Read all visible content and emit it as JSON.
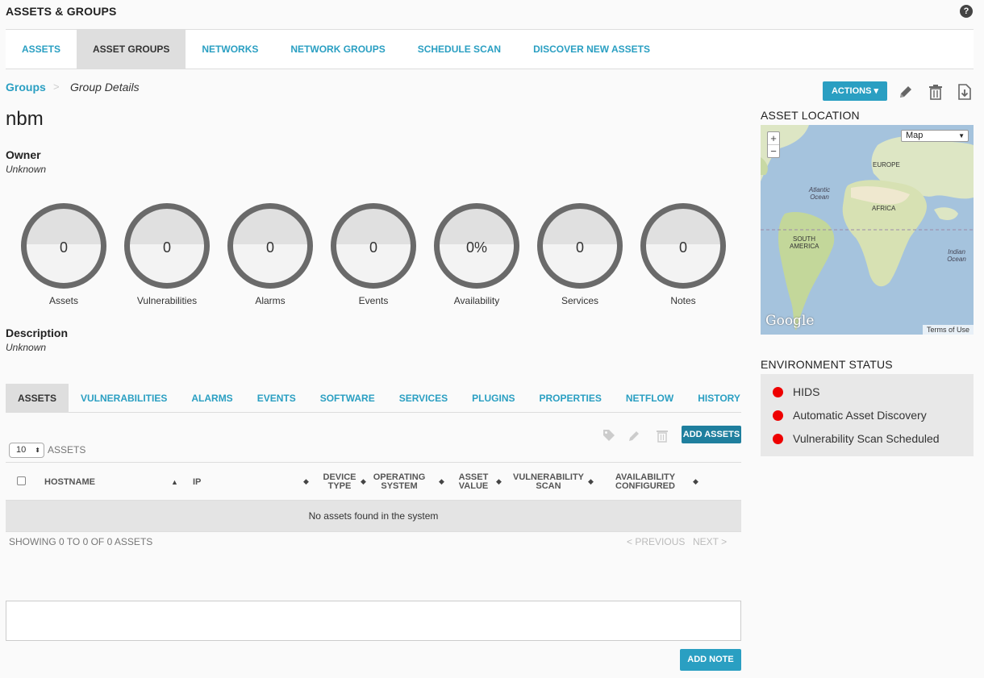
{
  "header": {
    "title": "ASSETS & GROUPS",
    "help_icon": "?"
  },
  "main_tabs": [
    {
      "label": "ASSETS"
    },
    {
      "label": "ASSET GROUPS"
    },
    {
      "label": "NETWORKS"
    },
    {
      "label": "NETWORK GROUPS"
    },
    {
      "label": "SCHEDULE SCAN"
    },
    {
      "label": "DISCOVER NEW ASSETS"
    }
  ],
  "breadcrumb": {
    "link": "Groups",
    "sep": ">",
    "current": "Group Details"
  },
  "toolbar": {
    "actions_label": "ACTIONS ▾"
  },
  "group": {
    "name": "nbm",
    "owner_label": "Owner",
    "owner_value": "Unknown",
    "description_label": "Description",
    "description_value": "Unknown"
  },
  "stats": [
    {
      "value": "0",
      "label": "Assets"
    },
    {
      "value": "0",
      "label": "Vulnerabilities"
    },
    {
      "value": "0",
      "label": "Alarms"
    },
    {
      "value": "0",
      "label": "Events"
    },
    {
      "value": "0%",
      "label": "Availability"
    },
    {
      "value": "0",
      "label": "Services"
    },
    {
      "value": "0",
      "label": "Notes"
    }
  ],
  "location": {
    "title": "ASSET LOCATION",
    "map_type": "Map",
    "zoom_in": "+",
    "zoom_out": "−",
    "labels": [
      "EUROPE",
      "Atlantic Ocean",
      "AFRICA",
      "SOUTH AMERICA",
      "Indian Ocean"
    ],
    "google": "Google",
    "terms": "Terms of Use"
  },
  "environment": {
    "title": "ENVIRONMENT STATUS",
    "items": [
      {
        "label": "HIDS",
        "status_color": "#e00000"
      },
      {
        "label": "Automatic Asset Discovery",
        "status_color": "#e00000"
      },
      {
        "label": "Vulnerability Scan Scheduled",
        "status_color": "#e00000"
      }
    ]
  },
  "sub_tabs": [
    {
      "label": "ASSETS"
    },
    {
      "label": "VULNERABILITIES"
    },
    {
      "label": "ALARMS"
    },
    {
      "label": "EVENTS"
    },
    {
      "label": "SOFTWARE"
    },
    {
      "label": "SERVICES"
    },
    {
      "label": "PLUGINS"
    },
    {
      "label": "PROPERTIES"
    },
    {
      "label": "NETFLOW"
    },
    {
      "label": "HISTORY"
    }
  ],
  "assets_table": {
    "add_label": "ADD ASSETS",
    "page_size": "10",
    "page_size_suffix": "ASSETS",
    "columns": [
      "HOSTNAME",
      "IP",
      "DEVICE TYPE",
      "OPERATING SYSTEM",
      "ASSET VALUE",
      "VULNERABILITY SCAN",
      "AVAILABILITY CONFIGURED"
    ],
    "empty_message": "No assets found in the system",
    "showing": "SHOWING 0 TO 0 OF 0 ASSETS",
    "prev": "< PREVIOUS",
    "next": "NEXT >"
  },
  "notes": {
    "add_label": "ADD NOTE"
  },
  "colors": {
    "accent": "#2a9fc2",
    "status_red": "#e00000"
  }
}
